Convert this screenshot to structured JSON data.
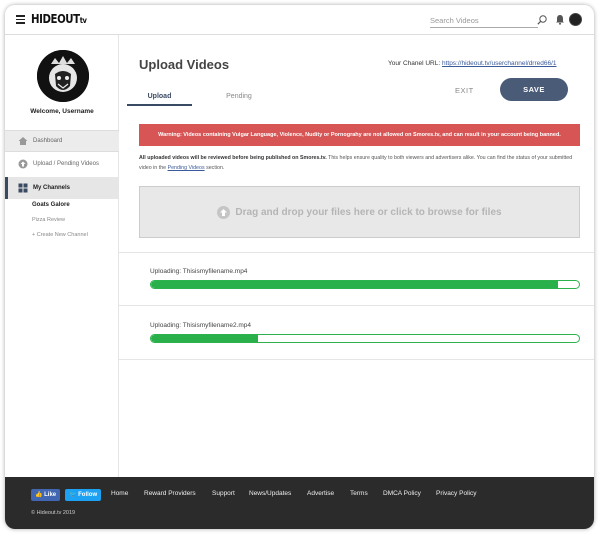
{
  "header": {
    "logo_main": "HIDEOUT",
    "logo_suffix": "tv",
    "search_placeholder": "Search Videos"
  },
  "sidebar": {
    "welcome": "Welcome, Username",
    "items": [
      {
        "label": "Dashboard",
        "icon": "home-icon"
      },
      {
        "label": "Upload / Pending Videos",
        "icon": "upload-icon"
      },
      {
        "label": "My Channels",
        "icon": "grid-icon"
      }
    ],
    "channels": [
      "Goats Galore",
      "Pizza Review"
    ],
    "create_channel": "+ Create New Channel"
  },
  "main": {
    "title": "Upload Videos",
    "channel_url_label": "Your Chanel URL:",
    "channel_url": "https://hideout.tv/userchannel/drred66/1",
    "tabs": [
      "Upload",
      "Pending"
    ],
    "exit_label": "EXIT",
    "save_label": "SAVE",
    "warning": "Warning: Videos containing Vulgar Language, Violence, Nudity or Pornograhy are not allowed on Smores.tv, and can result in your account being banned.",
    "info_bold": "All uploaded videos will be reviewed before being published on Smores.tv.",
    "info_text": "This helps ensure quality to both viewers and advertisers alike. You can find the status of your submitted video in the",
    "info_link": "Pending Videos",
    "info_end": "section.",
    "dropzone": "Drag and drop your files here or click to browse for files",
    "uploads": [
      {
        "label": "Uploading: Thisismyfilename.mp4",
        "progress": 0.95
      },
      {
        "label": "Uploading: Thisismyfilename2.mp4",
        "progress": 0.25
      }
    ]
  },
  "footer": {
    "like": "Like",
    "follow": "Follow",
    "links": [
      "Home",
      "Reward Providers",
      "Support",
      "News/Updates",
      "Advertise",
      "Terms",
      "DMCA Policy",
      "Privacy Policy"
    ],
    "copyright": "© Hideout.tv 2019"
  },
  "colors": {
    "accent": "#4a5b78",
    "warning": "#d85555",
    "progress": "#29b04a",
    "footer": "#2b2b2b"
  }
}
